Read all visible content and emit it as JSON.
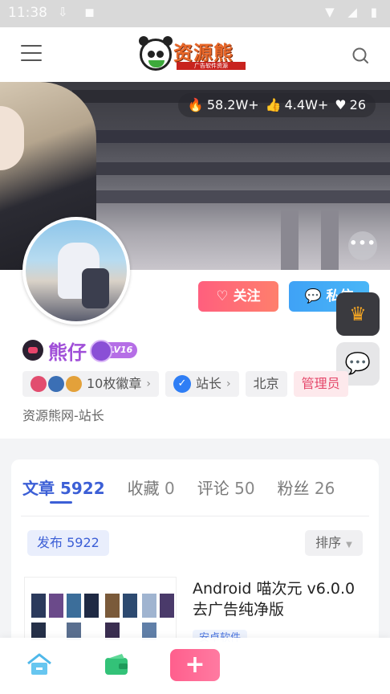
{
  "status_bar": {
    "time": "11:38",
    "left_icons": "⇩ ◼",
    "right_icons": "▼ ◢ ▮"
  },
  "header": {
    "brand": "资源熊",
    "tagline": "广告软件资源",
    "menu_icon": "hamburger-icon",
    "search_icon": "search-icon"
  },
  "banner": {
    "stats": [
      {
        "icon": "🔥",
        "value": "58.2W+"
      },
      {
        "icon": "👍",
        "value": "4.4W+"
      },
      {
        "icon": "♥",
        "value": "26"
      }
    ],
    "more_label": "•••"
  },
  "profile": {
    "follow_label": "关注",
    "follow_icon": "♡",
    "message_label": "私信",
    "message_icon": "💬",
    "username": "熊仔",
    "level": "LV16",
    "badges_label": "10枚徽章",
    "role_label": "站长",
    "location": "北京",
    "admin_label": "管理员",
    "bio": "资源熊网-站长"
  },
  "side_buttons": {
    "crown": "♛",
    "wechat": "💬"
  },
  "content": {
    "tabs": [
      {
        "label": "文章",
        "count": "5922"
      },
      {
        "label": "收藏",
        "count": "0"
      },
      {
        "label": "评论",
        "count": "50"
      },
      {
        "label": "粉丝",
        "count": "26"
      }
    ],
    "publish_label": "发布 5922",
    "sort_label": "排序",
    "article": {
      "title": "Android 喵次元 v6.0.0 去广告纯净版",
      "tag": "安卓软件"
    }
  },
  "bottom_nav": {
    "add_label": "+"
  },
  "colors": {
    "accent": "#3c5fd6",
    "pink": "#ff5f7e",
    "blue": "#3fa2f6",
    "purple": "#a04fd8"
  }
}
